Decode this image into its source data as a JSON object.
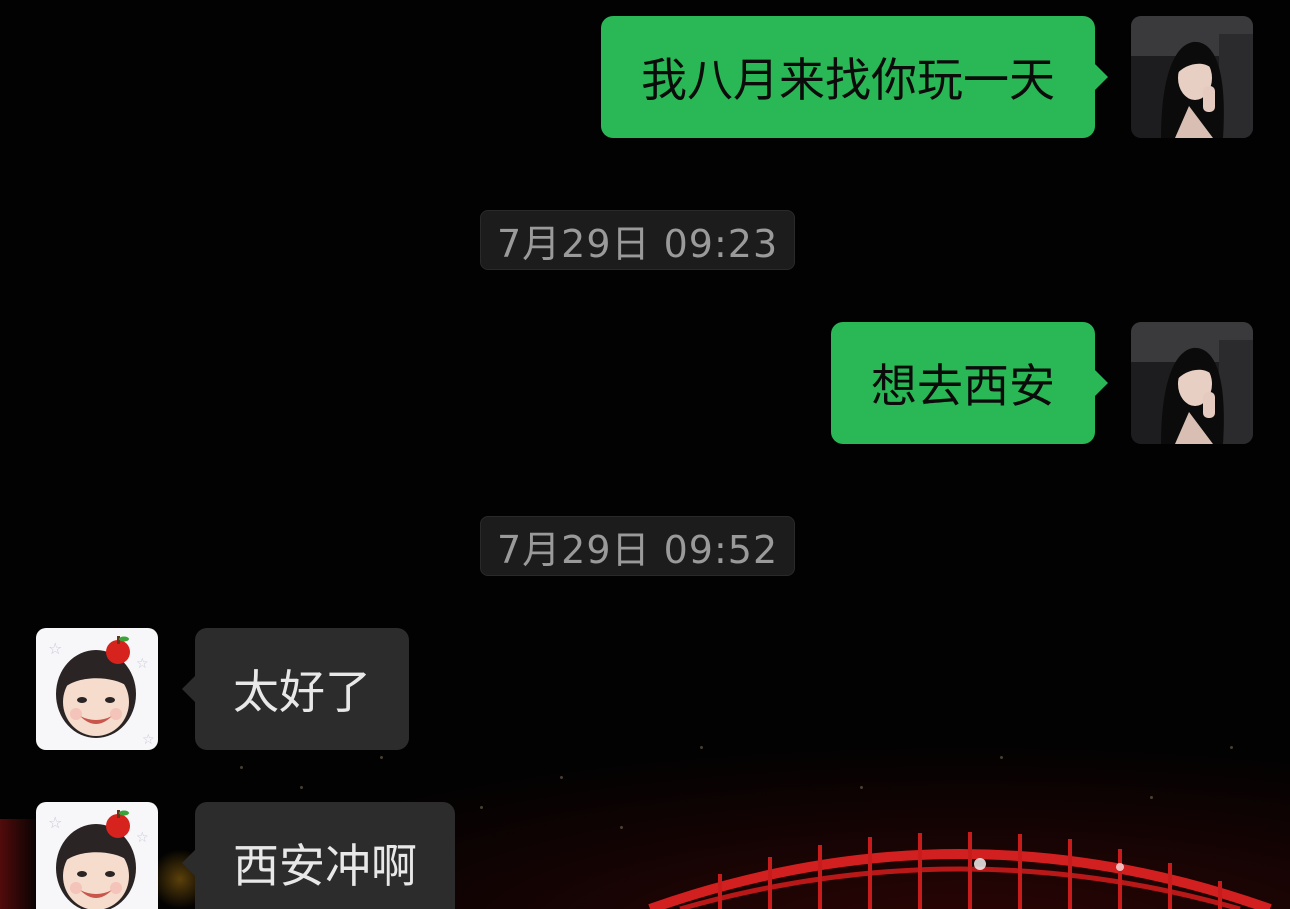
{
  "messages": [
    {
      "side": "out",
      "text": "我八月来找你玩一天"
    },
    {
      "side": "out",
      "text": "想去西安"
    },
    {
      "side": "in",
      "text": "太好了"
    },
    {
      "side": "in",
      "text": "西安冲啊"
    }
  ],
  "timestamps": [
    "7月29日 09:23",
    "7月29日 09:52"
  ],
  "colors": {
    "outgoing_bubble": "#2ab756",
    "incoming_bubble": "#2c2c2c",
    "background": "#020202",
    "timestamp_text": "#9a9a9a"
  },
  "avatars": {
    "self": "woman-portrait-avatar",
    "contact": "girl-with-apple-avatar"
  }
}
